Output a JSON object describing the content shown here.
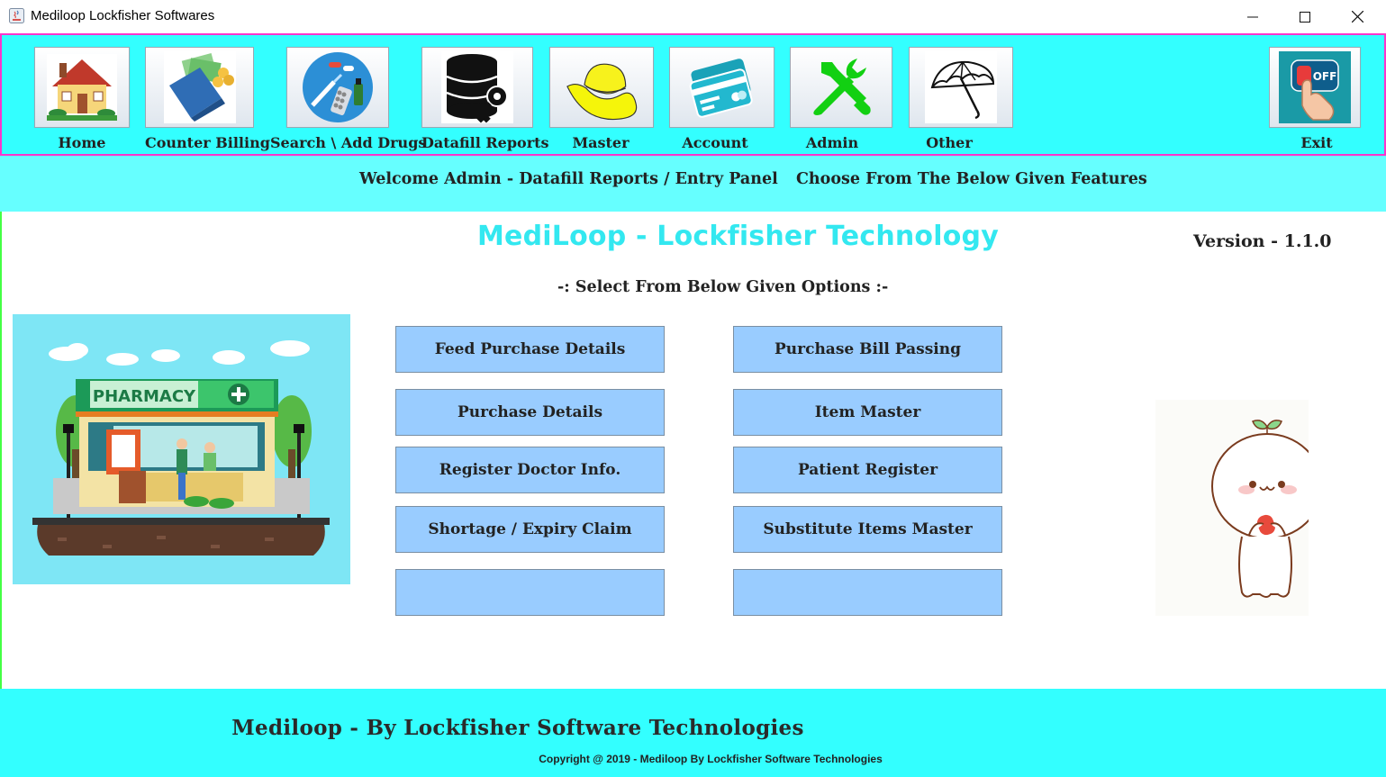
{
  "window": {
    "title": "Mediloop Lockfisher Softwares",
    "controls": {
      "minimize": "—",
      "maximize": "☐",
      "close": "✕"
    }
  },
  "toolbar": {
    "items": [
      {
        "label": "Home",
        "icon": "house-icon"
      },
      {
        "label": "Counter Billing",
        "icon": "wallet-icon"
      },
      {
        "label": "Search \\ Add Drugs",
        "icon": "medicine-icon"
      },
      {
        "label": "Datafill Reports",
        "icon": "database-key-icon"
      },
      {
        "label": "Master",
        "icon": "hat-icon"
      },
      {
        "label": "Account",
        "icon": "credit-card-icon"
      },
      {
        "label": "Admin",
        "icon": "tools-icon"
      },
      {
        "label": "Other",
        "icon": "umbrella-icon"
      },
      {
        "label": "Exit",
        "icon": "power-off-icon"
      }
    ],
    "exit_badge": "OFF"
  },
  "welcome": {
    "left": "Welcome Admin - Datafill Reports / Entry Panel",
    "right": "Choose From The Below Given Features"
  },
  "main": {
    "title": "MediLoop  - Lockfisher Technology",
    "version": "Version - 1.1.0",
    "select_label": "-: Select From Below Given Options :-",
    "pharmacy_sign": "PHARMACY",
    "options_left": [
      "Feed Purchase Details",
      "Purchase Details",
      "Register Doctor Info.",
      "Shortage  /  Expiry Claim",
      ""
    ],
    "options_right": [
      "Purchase Bill Passing",
      "Item Master",
      "Patient Register",
      "Substitute Items Master",
      ""
    ]
  },
  "footer": {
    "title": "Mediloop - By Lockfisher Software Technologies",
    "copyright": "Copyright @ 2019 - Mediloop By Lockfisher Software Technologies"
  },
  "colors": {
    "toolbar_bg": "#33ffff",
    "toolbar_border": "#ff33cc",
    "welcome_bg": "#66ffff",
    "option_bg": "#99ccff",
    "title_color": "#33e8f0",
    "footer_bg": "#33ffff"
  }
}
